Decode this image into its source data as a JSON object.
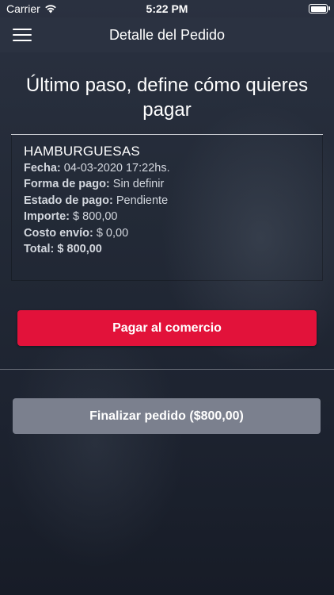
{
  "status_bar": {
    "carrier": "Carrier",
    "time": "5:22 PM"
  },
  "nav": {
    "title": "Detalle del Pedido"
  },
  "headline": "Último paso, define cómo quieres pagar",
  "order": {
    "name": "HAMBURGUESAS",
    "rows": [
      {
        "label": "Fecha:",
        "value": "04-03-2020 17:22hs."
      },
      {
        "label": "Forma de pago:",
        "value": "Sin definir"
      },
      {
        "label": "Estado de pago:",
        "value": "Pendiente"
      },
      {
        "label": "Importe:",
        "value": "$ 800,00"
      },
      {
        "label": "Costo envío:",
        "value": "$ 0,00"
      },
      {
        "label": "Total:",
        "value": "$ 800,00"
      }
    ]
  },
  "buttons": {
    "pay": "Pagar al comercio",
    "finish": "Finalizar pedido ($800,00)"
  },
  "colors": {
    "pay_button": "#e2123a",
    "finish_button": "#7b808e",
    "navbar": "#2b3241"
  },
  "icons": {
    "wifi": "wifi-icon",
    "battery": "battery-icon",
    "menu": "hamburger-menu-icon"
  }
}
